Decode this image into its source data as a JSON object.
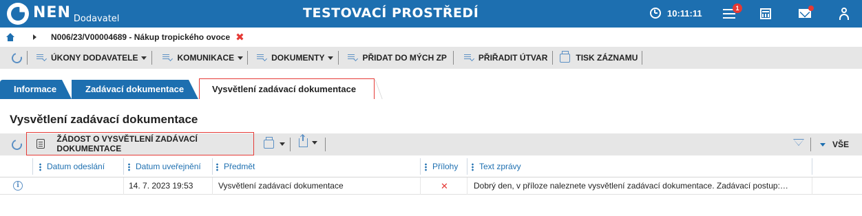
{
  "app": {
    "logo_text": "NEN",
    "logo_subtitle": "Dodavatel",
    "environment_title": "TESTOVACÍ PROSTŘEDÍ",
    "clock": "10:11:11",
    "notification_count": "1"
  },
  "breadcrumb": {
    "label": "N006/23/V00004689 - Nákup tropického ovoce",
    "close_symbol": "✖"
  },
  "actions": [
    {
      "label": "ÚKONY DODAVATELE",
      "dropdown": true
    },
    {
      "label": "KOMUNIKACE",
      "dropdown": true
    },
    {
      "label": "DOKUMENTY",
      "dropdown": true
    },
    {
      "label": "PŘIDAT DO MÝCH ZP",
      "dropdown": false
    },
    {
      "label": "PŘIŘADIT ÚTVAR",
      "dropdown": false
    },
    {
      "label": "TISK ZÁZNAMU",
      "dropdown": false
    }
  ],
  "tabs": [
    {
      "label": "Informace",
      "active": false
    },
    {
      "label": "Zadávací dokumentace",
      "active": false
    },
    {
      "label": "Vysvětlení zadávací dokumentace",
      "active": true
    }
  ],
  "section": {
    "title": "Vysvětlení zadávací dokumentace"
  },
  "table_toolbar": {
    "request_button": "ŽÁDOST O VYSVĚTLENÍ ZADÁVACÍ DOKUMENTACE",
    "view_all": "VŠE"
  },
  "table": {
    "columns": [
      "Datum odeslání",
      "Datum uveřejnění",
      "Předmět",
      "Přílohy",
      "Text zprávy"
    ],
    "rows": [
      {
        "datum_odeslani": "",
        "datum_uverejneni": "14. 7. 2023 19:53",
        "predmet": "Vysvětlení zadávací dokumentace",
        "prilohy": "✕",
        "text_zpravy": "Dobrý den, v příloze naleznete vysvětlení zadávací dokumentace. Zadávací postup:…"
      }
    ]
  },
  "colors": {
    "brand_blue": "#1d6fb0",
    "alert_red": "#e53935",
    "toolbar_gray": "#e6e6e6"
  }
}
